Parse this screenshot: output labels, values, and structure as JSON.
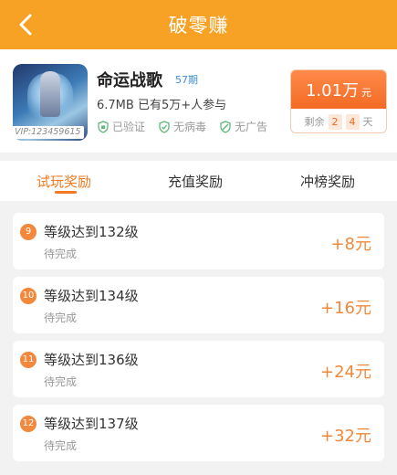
{
  "header": {
    "title": "破零赚",
    "back_icon": "back-arrow-icon"
  },
  "game": {
    "name": "命运战歌",
    "period": "57期",
    "meta": "6.7MB 已有5万+人参与",
    "vip": "VIP:123459615",
    "tags": [
      {
        "label": "已验证",
        "icon": "verified-shield-icon"
      },
      {
        "label": "无病毒",
        "icon": "no-virus-shield-icon"
      },
      {
        "label": "无广告",
        "icon": "no-ads-shield-icon"
      }
    ]
  },
  "reward": {
    "amount": "1.01万",
    "unit": "元",
    "remaining_label": "剩余",
    "days_tens": "2",
    "days_ones": "4",
    "days_unit": "天"
  },
  "tabs": [
    "试玩奖励",
    "充值奖励",
    "冲榜奖励"
  ],
  "active_tab": 0,
  "tasks": [
    {
      "num": "9",
      "title": "等级达到132级",
      "status": "待完成",
      "reward": "+8元"
    },
    {
      "num": "10",
      "title": "等级达到134级",
      "status": "待完成",
      "reward": "+16元"
    },
    {
      "num": "11",
      "title": "等级达到136级",
      "status": "待完成",
      "reward": "+24元"
    },
    {
      "num": "12",
      "title": "等级达到137级",
      "status": "待完成",
      "reward": "+32元"
    }
  ],
  "colors": {
    "accent": "#f7a225",
    "reward_orange": "#f36a24",
    "tab_active": "#f17a20"
  }
}
